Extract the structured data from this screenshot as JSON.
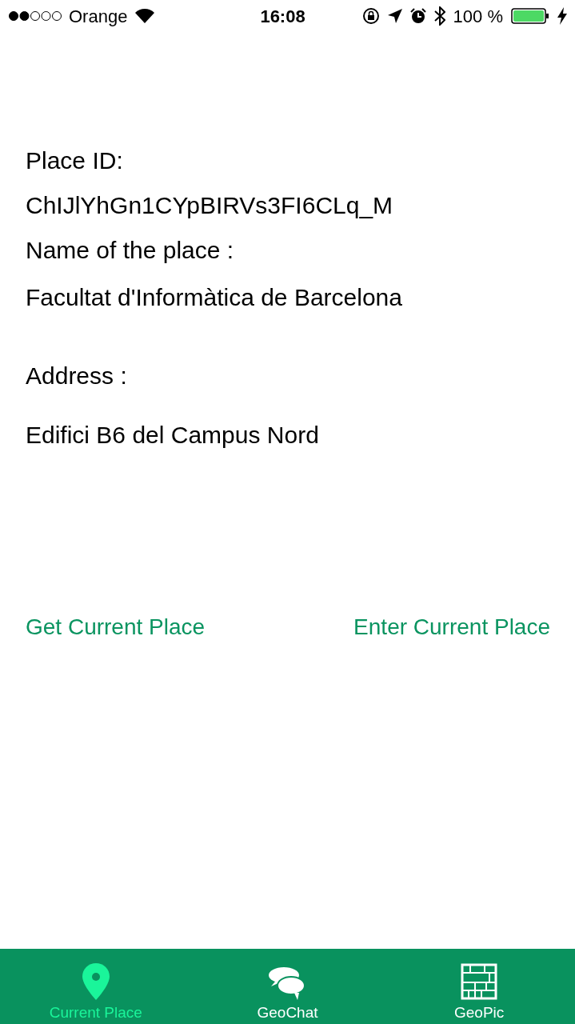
{
  "status_bar": {
    "carrier": "Orange",
    "time": "16:08",
    "battery": "100 %"
  },
  "fields": [
    {
      "label": "Place ID:",
      "value": "ChIJlYhGn1CYpBIRVs3FI6CLq_M"
    },
    {
      "label": "Name of the place :",
      "value": "Facultat d'Informàtica de Barcelona"
    },
    {
      "label": "Address :",
      "value": "Edifici B6 del Campus Nord"
    }
  ],
  "actions": [
    "Get Current Place",
    "Enter Current Place"
  ],
  "tabs": [
    {
      "label": "Current Place",
      "selected": true
    },
    {
      "label": "GeoChat",
      "selected": false
    },
    {
      "label": "GeoPic",
      "selected": false
    }
  ]
}
